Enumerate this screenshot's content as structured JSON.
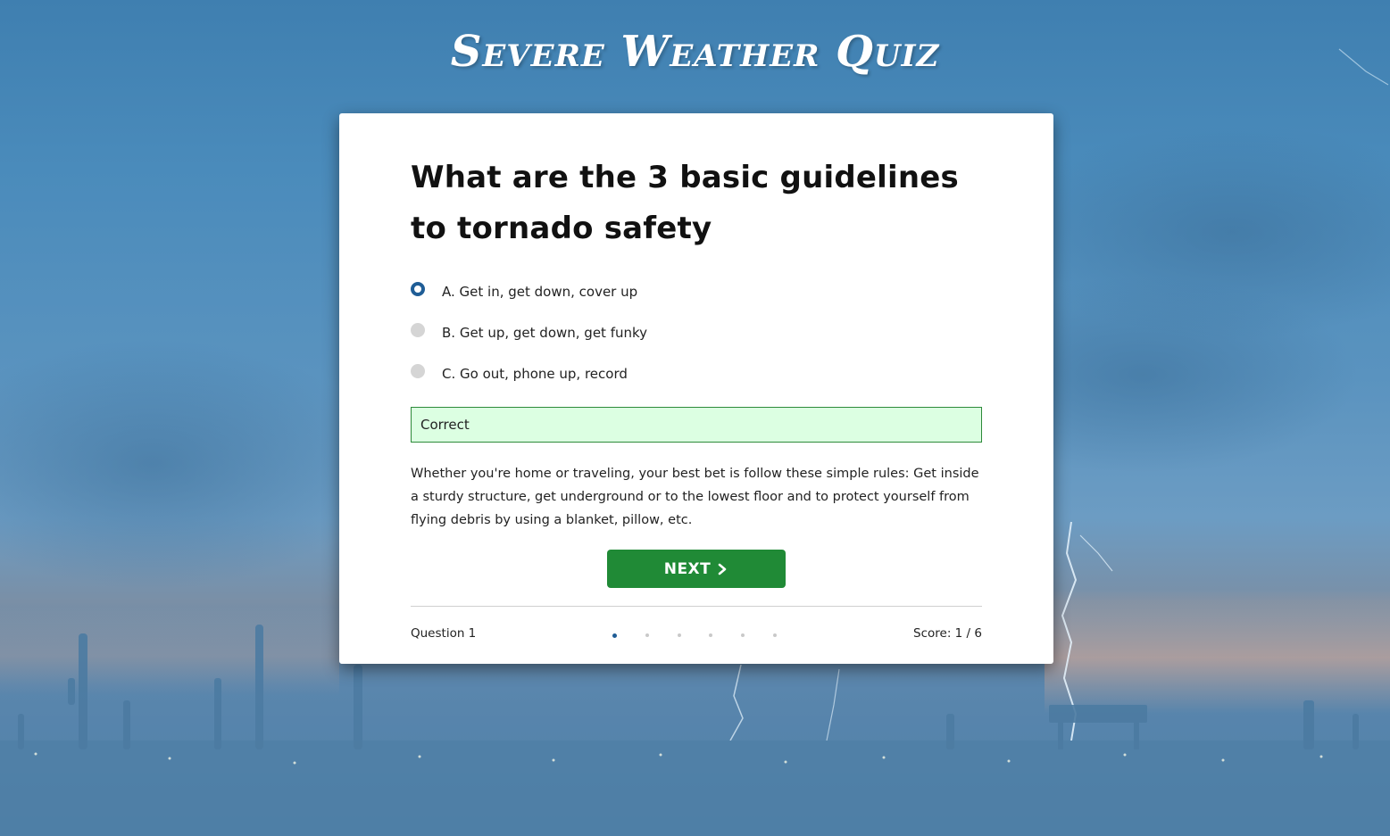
{
  "site": {
    "title": "Severe Weather Quiz"
  },
  "quiz": {
    "question": "What are the 3 basic guidelines to tornado safety",
    "options": [
      {
        "label": "A. Get in, get down, cover up",
        "selected": true
      },
      {
        "label": "B. Get up, get down, get funky",
        "selected": false
      },
      {
        "label": "C. Go out, phone up, record",
        "selected": false
      }
    ],
    "feedback": "Correct",
    "explanation": "Whether you're home or traveling, your best bet is follow these simple rules: Get inside a sturdy structure, get underground or to the lowest floor and to protect yourself from flying debris by using a blanket, pillow, etc.",
    "next_label": "NEXT",
    "next_icon": "chevron-right-icon"
  },
  "progress": {
    "question_label": "Question 1",
    "current": 1,
    "total": 6,
    "score_label": "Score: 1 / 6"
  },
  "colors": {
    "accent": "#1f5d96",
    "next_button": "#208a36",
    "feedback_bg": "#dcffe2",
    "feedback_border": "#2d8a3a",
    "sky": "#4a8bbb"
  }
}
